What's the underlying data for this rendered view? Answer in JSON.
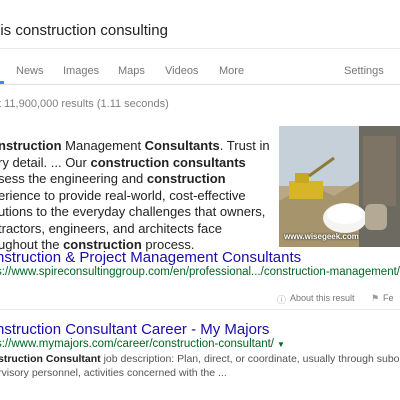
{
  "search": {
    "query": "t is construction consulting"
  },
  "tabs": [
    {
      "label": "News"
    },
    {
      "label": "Images"
    },
    {
      "label": "Maps"
    },
    {
      "label": "Videos"
    },
    {
      "label": "More"
    },
    {
      "label": "Settings"
    }
  ],
  "result_stats": "t 11,900,000 results (1.11 seconds)",
  "featured": {
    "snippet_lines": [
      [
        {
          "t": "nstruction",
          "b": true
        },
        {
          "t": " Management ",
          "b": false
        },
        {
          "t": "Consultants",
          "b": true
        },
        {
          "t": ". Trust in",
          "b": false
        }
      ],
      [
        {
          "t": "ry detail. ... Our ",
          "b": false
        },
        {
          "t": "construction consultants",
          "b": true
        }
      ],
      [
        {
          "t": "sess the engineering and ",
          "b": false
        },
        {
          "t": "construction",
          "b": true
        }
      ],
      [
        {
          "t": "erience to provide real-world, cost-effective",
          "b": false
        }
      ],
      [
        {
          "t": "utions to the everyday challenges that owners,",
          "b": false
        }
      ],
      [
        {
          "t": "tractors, engineers, and architects face",
          "b": false
        }
      ],
      [
        {
          "t": "ughout the ",
          "b": false
        },
        {
          "t": "construction",
          "b": true
        },
        {
          "t": " process.",
          "b": false
        }
      ]
    ],
    "image_caption": "www.wisegeek.com",
    "title": "nstruction & Project Management Consultants",
    "url": "s://www.spireconsultinggroup.com/en/professional.../construction-management/"
  },
  "feedback": {
    "about_label": "About this result",
    "feedback_label": "Fe"
  },
  "result2": {
    "title": "nstruction Consultant Career - My Majors",
    "url": "s://www.mymajors.com/career/construction-consultant/",
    "desc_lines": [
      [
        {
          "t": "struction Consultant",
          "b": true
        },
        {
          "t": " job description: Plan, direct, or coordinate, usually through subordinate",
          "b": false
        }
      ],
      [
        {
          "t": "rvisory personnel, activities concerned with the ...",
          "b": false
        }
      ]
    ]
  },
  "colors": {
    "link": "#1a0dab",
    "url": "#006621",
    "accent": "#4285f4"
  }
}
